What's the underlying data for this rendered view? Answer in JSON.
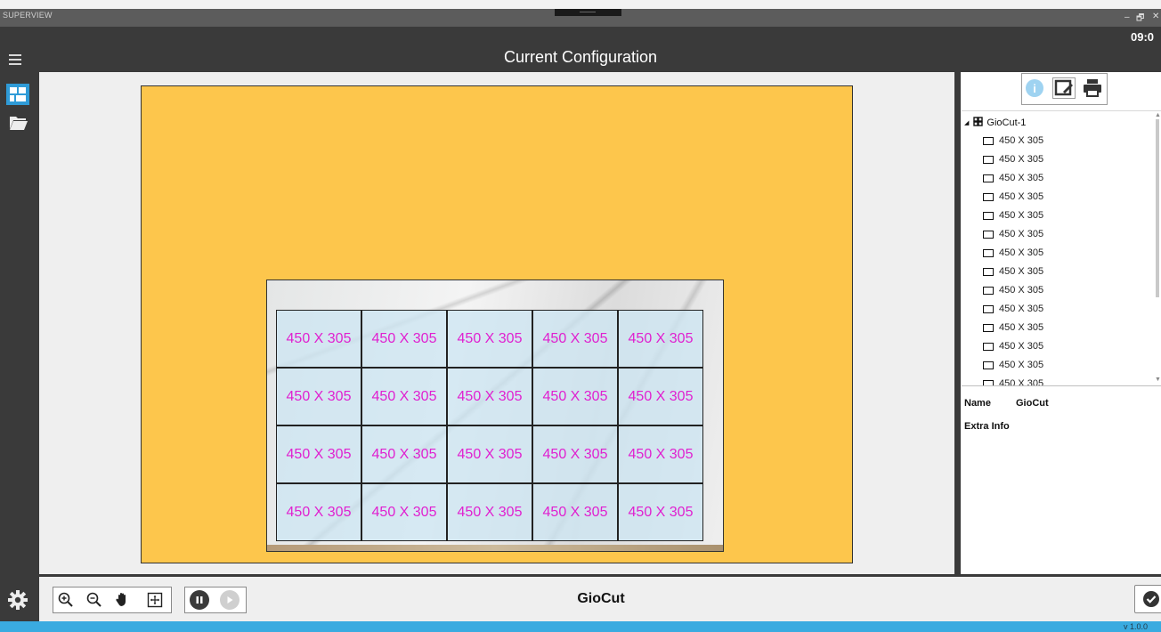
{
  "window": {
    "app_name": "SUPERVIEW",
    "minimize_glyph": "–",
    "maximize_glyph": "🗗",
    "close_glyph": "✕"
  },
  "header": {
    "title": "Current Configuration",
    "clock": "09:0"
  },
  "rail": {
    "items": [
      {
        "icon": "grid-layout-icon",
        "active": true
      },
      {
        "icon": "folder-open-icon",
        "active": false
      },
      {
        "icon": "gear-icon",
        "active": false
      }
    ]
  },
  "canvas": {
    "sheet_color": "#fdc64c",
    "piece_text_color": "#e020d0",
    "pieces": [
      [
        "450 X 305",
        "450 X 305",
        "450 X 305",
        "450 X 305",
        "450 X 305"
      ],
      [
        "450 X 305",
        "450 X 305",
        "450 X 305",
        "450 X 305",
        "450 X 305"
      ],
      [
        "450 X 305",
        "450 X 305",
        "450 X 305",
        "450 X 305",
        "450 X 305"
      ],
      [
        "450 X 305",
        "450 X 305",
        "450 X 305",
        "450 X 305",
        "450 X 305"
      ]
    ]
  },
  "tree": {
    "root": "GioCut-1",
    "items": [
      "450 X 305",
      "450 X 305",
      "450 X 305",
      "450 X 305",
      "450 X 305",
      "450 X 305",
      "450 X 305",
      "450 X 305",
      "450 X 305",
      "450 X 305",
      "450 X 305",
      "450 X 305",
      "450 X 305",
      "450 X 305"
    ]
  },
  "properties": {
    "name_label": "Name",
    "name_value": "GioCut",
    "extra_label": "Extra Info"
  },
  "toolbar": {
    "tools": [
      "zoom-in-icon",
      "zoom-out-icon",
      "pan-hand-icon",
      "fit-view-icon"
    ],
    "project_name": "GioCut"
  },
  "status": {
    "version": "v 1.0.0",
    "accent": "#3aabe0"
  }
}
